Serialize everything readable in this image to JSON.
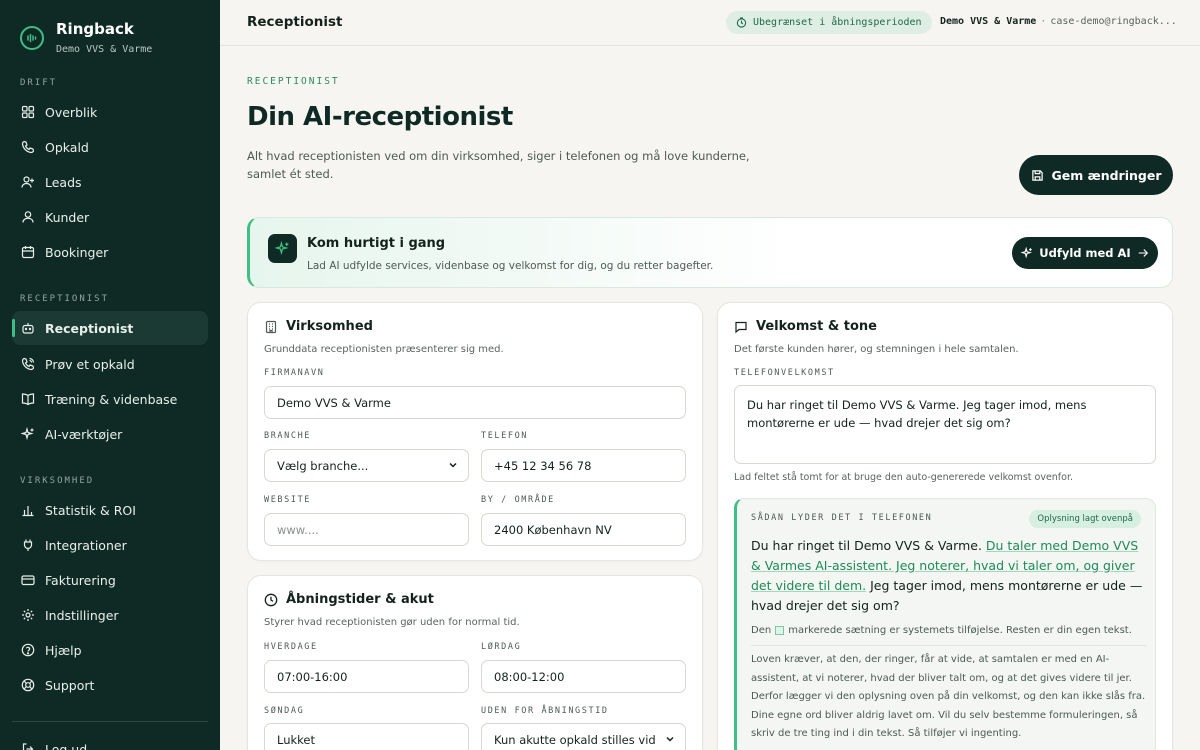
{
  "brand": {
    "name": "Ringback",
    "company": "Demo VVS & Varme"
  },
  "sidebar": {
    "sections": {
      "drift": "DRIFT",
      "receptionist": "RECEPTIONIST",
      "virksomhed": "VIRKSOMHED"
    },
    "items": [
      {
        "label": "Overblik",
        "icon": "grid-icon"
      },
      {
        "label": "Opkald",
        "icon": "phone-icon"
      },
      {
        "label": "Leads",
        "icon": "user-plus-icon"
      },
      {
        "label": "Kunder",
        "icon": "user-icon"
      },
      {
        "label": "Bookinger",
        "icon": "calendar-icon"
      },
      {
        "label": "Receptionist",
        "icon": "bot-icon",
        "active": true
      },
      {
        "label": "Prøv et opkald",
        "icon": "phone-call-icon"
      },
      {
        "label": "Træning & videnbase",
        "icon": "book-icon"
      },
      {
        "label": "AI-værktøjer",
        "icon": "sparkles-icon"
      },
      {
        "label": "Statistik & ROI",
        "icon": "bar-chart-icon"
      },
      {
        "label": "Integrationer",
        "icon": "plug-icon"
      },
      {
        "label": "Fakturering",
        "icon": "credit-card-icon"
      },
      {
        "label": "Indstillinger",
        "icon": "settings-icon"
      },
      {
        "label": "Hjælp",
        "icon": "help-circle-icon"
      },
      {
        "label": "Support",
        "icon": "life-buoy-icon"
      }
    ],
    "logout": "Log ud"
  },
  "header": {
    "title": "Receptionist",
    "trial": "Ubegrænset i åbningsperioden",
    "account_name": "Demo VVS & Varme",
    "account_sep": "·",
    "account_email": "case-demo@ringback..."
  },
  "page": {
    "eyebrow": "RECEPTIONIST",
    "title": "Din AI-receptionist",
    "lead": "Alt hvad receptionisten ved om din virksomhed, siger i telefonen og må love kunderne, samlet ét sted.",
    "save_label": "Gem ændringer"
  },
  "quickstart": {
    "title": "Kom hurtigt i gang",
    "subtitle": "Lad AI udfylde services, videnbase og velkomst for dig, og du retter bagefter.",
    "button": "Udfyld med AI"
  },
  "company": {
    "title": "Virksomhed",
    "subtitle": "Grunddata receptionisten præsenterer sig med.",
    "name_label": "FIRMANAVN",
    "name_value": "Demo VVS & Varme",
    "industry_label": "BRANCHE",
    "industry_value": "Vælg branche...",
    "phone_label": "TELEFON",
    "phone_value": "+45 12 34 56 78",
    "website_label": "WEBSITE",
    "website_placeholder": "www....",
    "city_label": "BY / OMRÅDE",
    "city_value": "2400 København NV"
  },
  "hours": {
    "title": "Åbningstider & akut",
    "subtitle": "Styrer hvad receptionisten gør uden for normal tid.",
    "weekday_label": "HVERDAGE",
    "weekday_value": "07:00-16:00",
    "saturday_label": "LØRDAG",
    "saturday_value": "08:00-12:00",
    "sunday_label": "SØNDAG",
    "sunday_value": "Lukket",
    "outside_label": "UDEN FOR ÅBNINGSTID",
    "outside_value": "Kun akutte opkald stilles vid"
  },
  "welcome": {
    "title": "Velkomst & tone",
    "subtitle": "Det første kunden hører, og stemningen i hele samtalen.",
    "greeting_label": "TELEFONVELKOMST",
    "greeting_value": "Du har ringet til Demo VVS & Varme. Jeg tager imod, mens montørerne er ude — hvad drejer det sig om?",
    "hint": "Lad feltet stå tomt for at bruge den auto-genererede velkomst ovenfor.",
    "preview_label": "SÅDAN LYDER DET I TELEFONEN",
    "preview_pill": "Oplysning lagt ovenpå",
    "preview_part1": "Du har ringet til Demo VVS & Varme. ",
    "preview_highlight": "Du taler med Demo VVS & Varmes AI-assistent. Jeg noterer, hvad vi taler om, og giver det videre til dem.",
    "preview_part2": " Jeg tager imod, mens montørerne er ude — hvad drejer det sig om?",
    "note_before": "Den",
    "note_after": "markerede sætning er systemets tilføjelse. Resten er din egen tekst.",
    "law_text": "Loven kræver, at den, der ringer, får at vide, at samtalen er med en AI-assistent, at vi noterer, hvad der bliver talt om, og at det gives videre til jer. Derfor lægger vi den oplysning oven på din velkomst, og den kan ikke slås fra. Dine egne ord bliver aldrig lavet om. Vil du selv bestemme formuleringen, så skriv de tre ting ind i din tekst. Så tilføjer vi ingenting."
  },
  "colors": {
    "sidebar": "#0f2a24",
    "accent": "#3fbf83",
    "background": "#f6f5f1"
  }
}
